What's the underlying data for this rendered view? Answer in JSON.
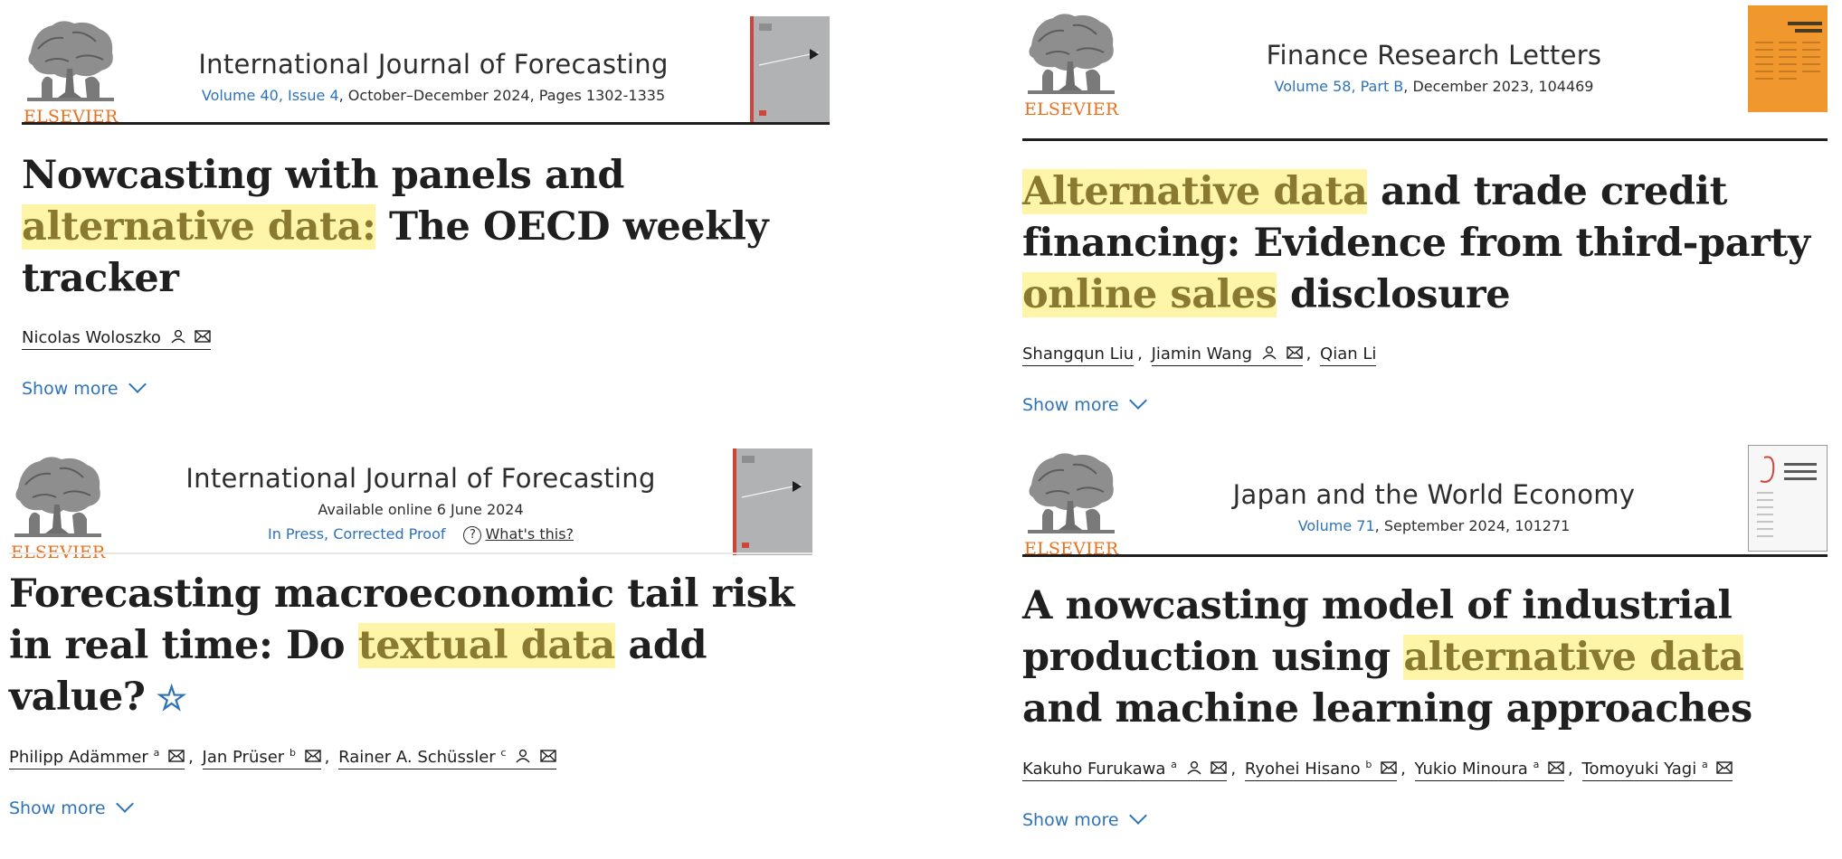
{
  "colors": {
    "accent": "#2e73b8",
    "highlight": "#fff5a8",
    "elsevier": "#e9711c"
  },
  "articles": [
    {
      "logo_text": "ELSEVIER",
      "journal": "International Journal of Forecasting",
      "volume_link": "Volume 40, Issue 4",
      "issue_rest": ", October–December 2024, Pages 1302-1335",
      "title_a": "Nowcasting with panels and ",
      "title_hl1": "alternative data:",
      "title_b": " The OECD weekly tracker",
      "authors": [
        {
          "name": "Nicolas Woloszko",
          "sup": ""
        }
      ],
      "show_more": "Show more"
    },
    {
      "logo_text": "ELSEVIER",
      "journal": "Finance Research Letters",
      "volume_link": "Volume 58, Part B",
      "issue_rest": ", December 2023, 104469",
      "title_hl1": "Alternative data",
      "title_a": " and trade credit financing: Evidence from third-party ",
      "title_hl2": "online sales",
      "title_b": " disclosure",
      "authors": [
        {
          "name": "Shangqun Liu"
        },
        {
          "name": "Jiamin Wang"
        },
        {
          "name": "Qian Li"
        }
      ],
      "show_more": "Show more"
    },
    {
      "logo_text": "ELSEVIER",
      "journal": "International Journal of Forecasting",
      "available": "Available online 6 June 2024",
      "in_press": "In Press, Corrected Proof",
      "whats_this": "What's this?",
      "title_a": "Forecasting macroeconomic tail risk in real time: Do ",
      "title_hl1": "textual data",
      "title_b": " add value?",
      "star": "☆",
      "authors": [
        {
          "name": "Philipp Adämmer",
          "sup": "a"
        },
        {
          "name": "Jan Prüser",
          "sup": "b"
        },
        {
          "name": "Rainer A. Schüssler",
          "sup": "c"
        }
      ],
      "show_more": "Show more"
    },
    {
      "logo_text": "ELSEVIER",
      "journal": "Japan and the World Economy",
      "volume_link": "Volume 71",
      "issue_rest": ", September 2024, 101271",
      "title_a": "A nowcasting model of industrial production using ",
      "title_hl1": "alternative data",
      "title_b": " and machine learning approaches",
      "authors": [
        {
          "name": "Kakuho Furukawa",
          "sup": "a"
        },
        {
          "name": "Ryohei Hisano",
          "sup": "b"
        },
        {
          "name": "Yukio Minoura",
          "sup": "a"
        },
        {
          "name": "Tomoyuki Yagi",
          "sup": "a"
        }
      ],
      "show_more": "Show more"
    }
  ]
}
